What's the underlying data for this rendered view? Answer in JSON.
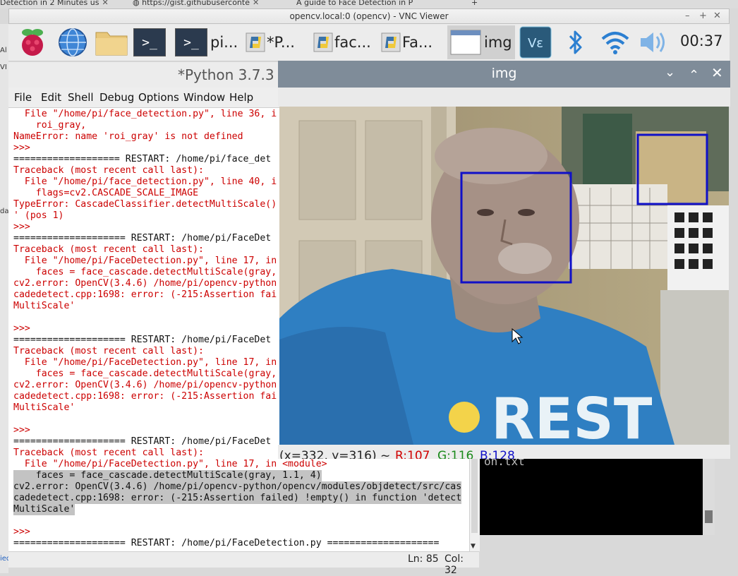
{
  "browser_tabs": [
    {
      "label": "Detection in 2 Minutes us"
    },
    {
      "label": "https://gist.githubuserconte"
    },
    {
      "label": "A guide to Face Detection in P"
    }
  ],
  "vnc": {
    "title": "opencv.local:0 (opencv) - VNC Viewer"
  },
  "taskbar": {
    "items": [
      {
        "label": "pi..."
      },
      {
        "label": "*P..."
      },
      {
        "label": "fac..."
      },
      {
        "label": "Fa..."
      },
      {
        "label": "img"
      }
    ],
    "clock": "00:37"
  },
  "left_strip": [
    "Al",
    "VI",
    "da",
    "ied"
  ],
  "idle": {
    "title": "*Python 3.7.3 S",
    "menu": [
      "File",
      "Edit",
      "Shell",
      "Debug",
      "Options",
      "Window",
      "Help"
    ],
    "lines": [
      {
        "t": "  File \"/home/pi/face_detection.py\", line 36, i",
        "c": "r"
      },
      {
        "t": "    roi_gray,",
        "c": "r"
      },
      {
        "t": "NameError: name 'roi_gray' is not defined",
        "c": "r"
      },
      {
        "t": ">>>",
        "c": "r"
      },
      {
        "t": "=================== RESTART: /home/pi/face_det",
        "c": "k"
      },
      {
        "t": "Traceback (most recent call last):",
        "c": "r"
      },
      {
        "t": "  File \"/home/pi/face_detection.py\", line 40, i",
        "c": "r"
      },
      {
        "t": "    flags=cv2.CASCADE_SCALE_IMAGE",
        "c": "r"
      },
      {
        "t": "TypeError: CascadeClassifier.detectMultiScale()",
        "c": "r"
      },
      {
        "t": "' (pos 1)",
        "c": "r"
      },
      {
        "t": ">>>",
        "c": "r"
      },
      {
        "t": "==================== RESTART: /home/pi/FaceDet",
        "c": "k"
      },
      {
        "t": "Traceback (most recent call last):",
        "c": "r"
      },
      {
        "t": "  File \"/home/pi/FaceDetection.py\", line 17, in",
        "c": "r"
      },
      {
        "t": "    faces = face_cascade.detectMultiScale(gray,",
        "c": "r"
      },
      {
        "t": "cv2.error: OpenCV(3.4.6) /home/pi/opencv-python",
        "c": "r"
      },
      {
        "t": "cadedetect.cpp:1698: error: (-215:Assertion fai",
        "c": "r"
      },
      {
        "t": "MultiScale'",
        "c": "r"
      },
      {
        "t": "",
        "c": "r"
      },
      {
        "t": ">>>",
        "c": "r"
      },
      {
        "t": "==================== RESTART: /home/pi/FaceDet",
        "c": "k"
      },
      {
        "t": "Traceback (most recent call last):",
        "c": "r"
      },
      {
        "t": "  File \"/home/pi/FaceDetection.py\", line 17, in",
        "c": "r"
      },
      {
        "t": "    faces = face_cascade.detectMultiScale(gray,",
        "c": "r"
      },
      {
        "t": "cv2.error: OpenCV(3.4.6) /home/pi/opencv-python",
        "c": "r"
      },
      {
        "t": "cadedetect.cpp:1698: error: (-215:Assertion fai",
        "c": "r"
      },
      {
        "t": "MultiScale'",
        "c": "r"
      },
      {
        "t": "",
        "c": "r"
      },
      {
        "t": ">>>",
        "c": "r"
      },
      {
        "t": "==================== RESTART: /home/pi/FaceDet",
        "c": "k"
      },
      {
        "t": "Traceback (most recent call last):",
        "c": "r"
      },
      {
        "t": "  File \"/home/pi/FaceDetection.py\", line 17, in <module>",
        "c": "r"
      },
      {
        "t": "    faces = face_cascade.detectMultiScale(gray, 1.1, 4)",
        "c": "kh"
      },
      {
        "t": "cv2.error: OpenCV(3.4.6) /home/pi/opencv-python/opencv/modules/objdetect/src/cas",
        "c": "kh"
      },
      {
        "t": "cadedetect.cpp:1698: error: (-215:Assertion failed) !empty() in function 'detect",
        "c": "kh"
      },
      {
        "t": "MultiScale'",
        "c": "kh"
      },
      {
        "t": "",
        "c": "r"
      },
      {
        "t": ">>>",
        "c": "r"
      },
      {
        "t": "==================== RESTART: /home/pi/FaceDetection.py ====================",
        "c": "k"
      }
    ],
    "status": {
      "ln": "Ln: 85",
      "col": "Col: 32"
    }
  },
  "img_window": {
    "title": "img",
    "status_coords": "(x=332, y=316) ~",
    "status_r": "R:107",
    "status_g": "G:116",
    "status_b": "B:128"
  },
  "terminal": {
    "text": "on.txt"
  },
  "colors": {
    "error_red": "#cc0000",
    "face_box": "#1010c8",
    "titlebar": "#7f8c99"
  }
}
